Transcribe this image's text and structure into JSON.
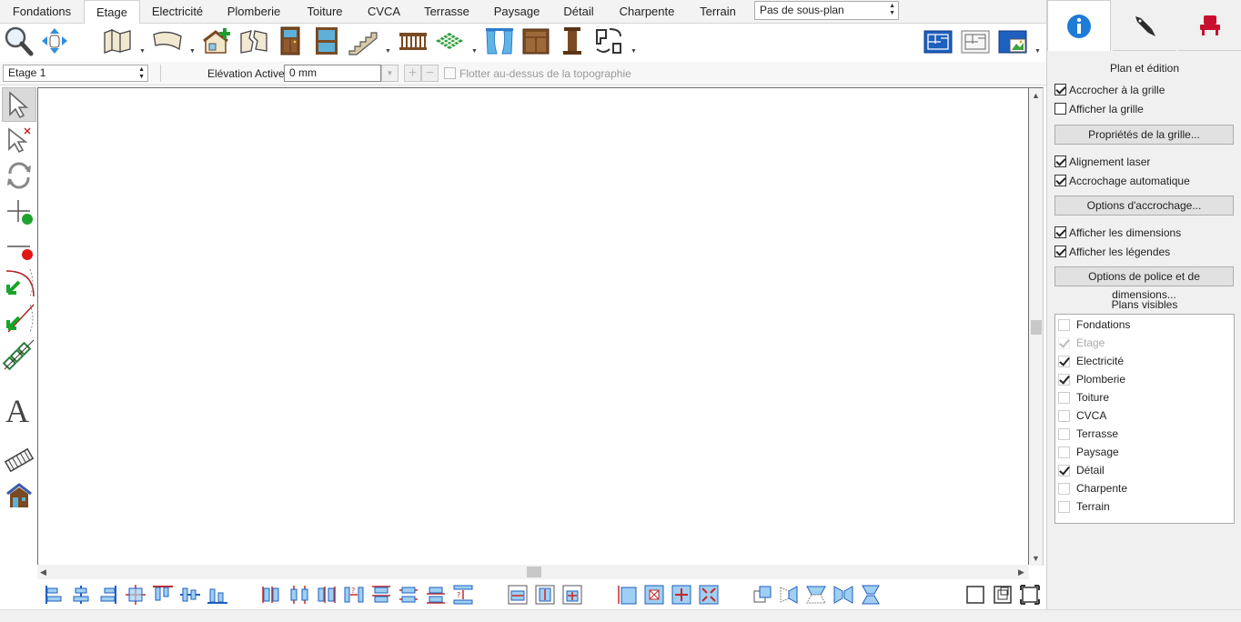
{
  "tabs": [
    "Fondations",
    "Etage",
    "Electricité",
    "Plomberie",
    "Toiture",
    "CVCA",
    "Terrasse",
    "Paysage",
    "Détail",
    "Charpente",
    "Terrain"
  ],
  "active_tab": "Etage",
  "subplan_select": "Pas de sous-plan",
  "level_select": "Etage 1",
  "elevation": {
    "label": "Elévation Active:",
    "value": "0 mm",
    "float_label": "Flotter au-dessus de la topographie"
  },
  "panel": {
    "section_title": "Plan et édition",
    "snap_grid": "Accrocher à la grille",
    "show_grid": "Afficher la grille",
    "grid_props_button": "Propriétés de la grille...",
    "laser_align": "Alignement laser",
    "auto_snap": "Accrochage automatique",
    "snap_options_button": "Options d'accrochage...",
    "show_dimensions": "Afficher les dimensions",
    "show_labels": "Afficher les légendes",
    "font_dim_button": "Options de police et de dimensions...",
    "visible_plans_title": "Plans visibles",
    "visible_plans": [
      "Fondations",
      "Etage",
      "Electricité",
      "Plomberie",
      "Toiture",
      "CVCA",
      "Terrasse",
      "Paysage",
      "Détail",
      "Charpente",
      "Terrain"
    ]
  },
  "colors": {
    "accent_blue": "#1e7bd6",
    "furniture_red": "#c8102e",
    "toolbar_brown": "#7a4a22"
  },
  "icons": {
    "toolbar": [
      "zoom-icon",
      "pan-icon",
      "wall-icon",
      "curved-wall-icon",
      "add-room-icon",
      "broken-wall-icon",
      "door-icon",
      "window-icon",
      "stairs-icon",
      "railing-icon",
      "floor-tile-icon",
      "curtain-icon",
      "cabinet-icon",
      "column-icon",
      "shape-icon",
      "view-plan-icon",
      "view-2d-icon",
      "view-3d-icon"
    ],
    "left": [
      "select-icon",
      "multi-select-icon",
      "rotate-icon",
      "add-point-icon",
      "remove-point-icon",
      "split-arc-icon",
      "split-line-icon",
      "chain-icon",
      "text-icon",
      "camera-icon",
      "house-icon"
    ],
    "panel_tabs": [
      "info-icon",
      "pen-icon",
      "furniture-icon"
    ]
  }
}
